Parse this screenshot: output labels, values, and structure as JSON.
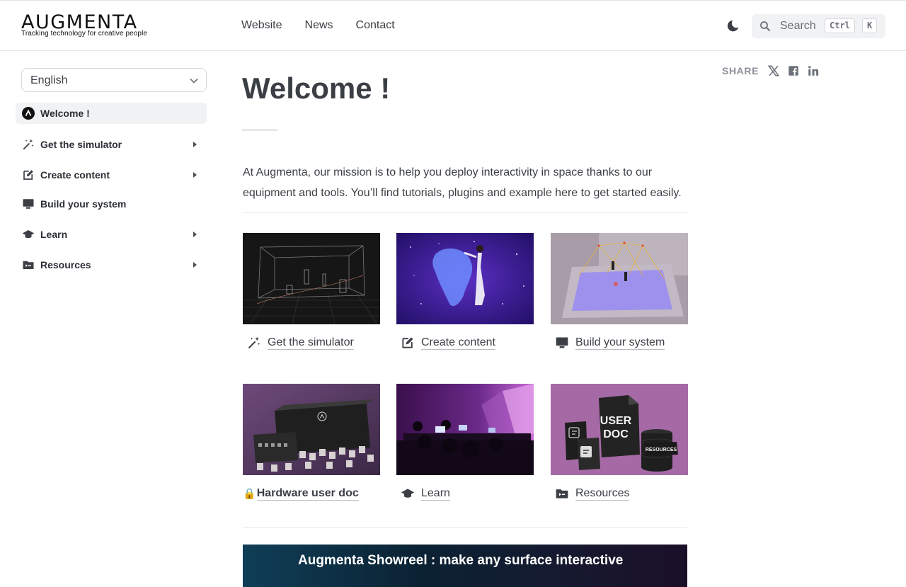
{
  "brand": {
    "name": "AUGMENTA",
    "tagline": "Tracking technology for creative people"
  },
  "topnav": {
    "items": [
      "Website",
      "News",
      "Contact"
    ]
  },
  "search": {
    "placeholder": "Search",
    "shortcut_ctrl": "Ctrl",
    "shortcut_key": "K"
  },
  "language": {
    "selected": "English"
  },
  "sidebar": {
    "items": [
      {
        "label": "Welcome !",
        "icon": "augmenta-logo-icon",
        "active": true,
        "expandable": false
      },
      {
        "label": "Get the simulator",
        "icon": "magic-wand-icon",
        "active": false,
        "expandable": true
      },
      {
        "label": "Create content",
        "icon": "edit-square-icon",
        "active": false,
        "expandable": true
      },
      {
        "label": "Build your system",
        "icon": "monitor-icon",
        "active": false,
        "expandable": false
      },
      {
        "label": "Learn",
        "icon": "graduation-cap-icon",
        "active": false,
        "expandable": true
      },
      {
        "label": "Resources",
        "icon": "folder-icon",
        "active": false,
        "expandable": true
      }
    ]
  },
  "main": {
    "title": "Welcome !",
    "intro": "At Augmenta, our mission is to help you deploy interactivity in space thanks to our equipment and tools. You’ll find tutorials, plugins and example here to get started easily.",
    "cards": [
      {
        "label": "Get the simulator",
        "icon": "magic-wand-icon"
      },
      {
        "label": "Create content",
        "icon": "edit-square-icon"
      },
      {
        "label": "Build your system",
        "icon": "monitor-icon"
      },
      {
        "label": "Hardware user doc",
        "icon": "lock-icon"
      },
      {
        "label": "Learn",
        "icon": "graduation-cap-icon"
      },
      {
        "label": "Resources",
        "icon": "folder-icon"
      }
    ],
    "thumb_text": {
      "user_doc_line1": "USER",
      "user_doc_line2": "DOC",
      "resources": "RESOURCES"
    },
    "lock_glyph": "🔒",
    "video_title": "Augmenta Showreel : make any surface interactive"
  },
  "share": {
    "label": "SHARE",
    "networks": [
      "x-icon",
      "facebook-icon",
      "linkedin-icon"
    ]
  },
  "colors": {
    "text": "#3b3f45",
    "active_bg": "#f1f2f4",
    "muted": "#8d9199"
  }
}
